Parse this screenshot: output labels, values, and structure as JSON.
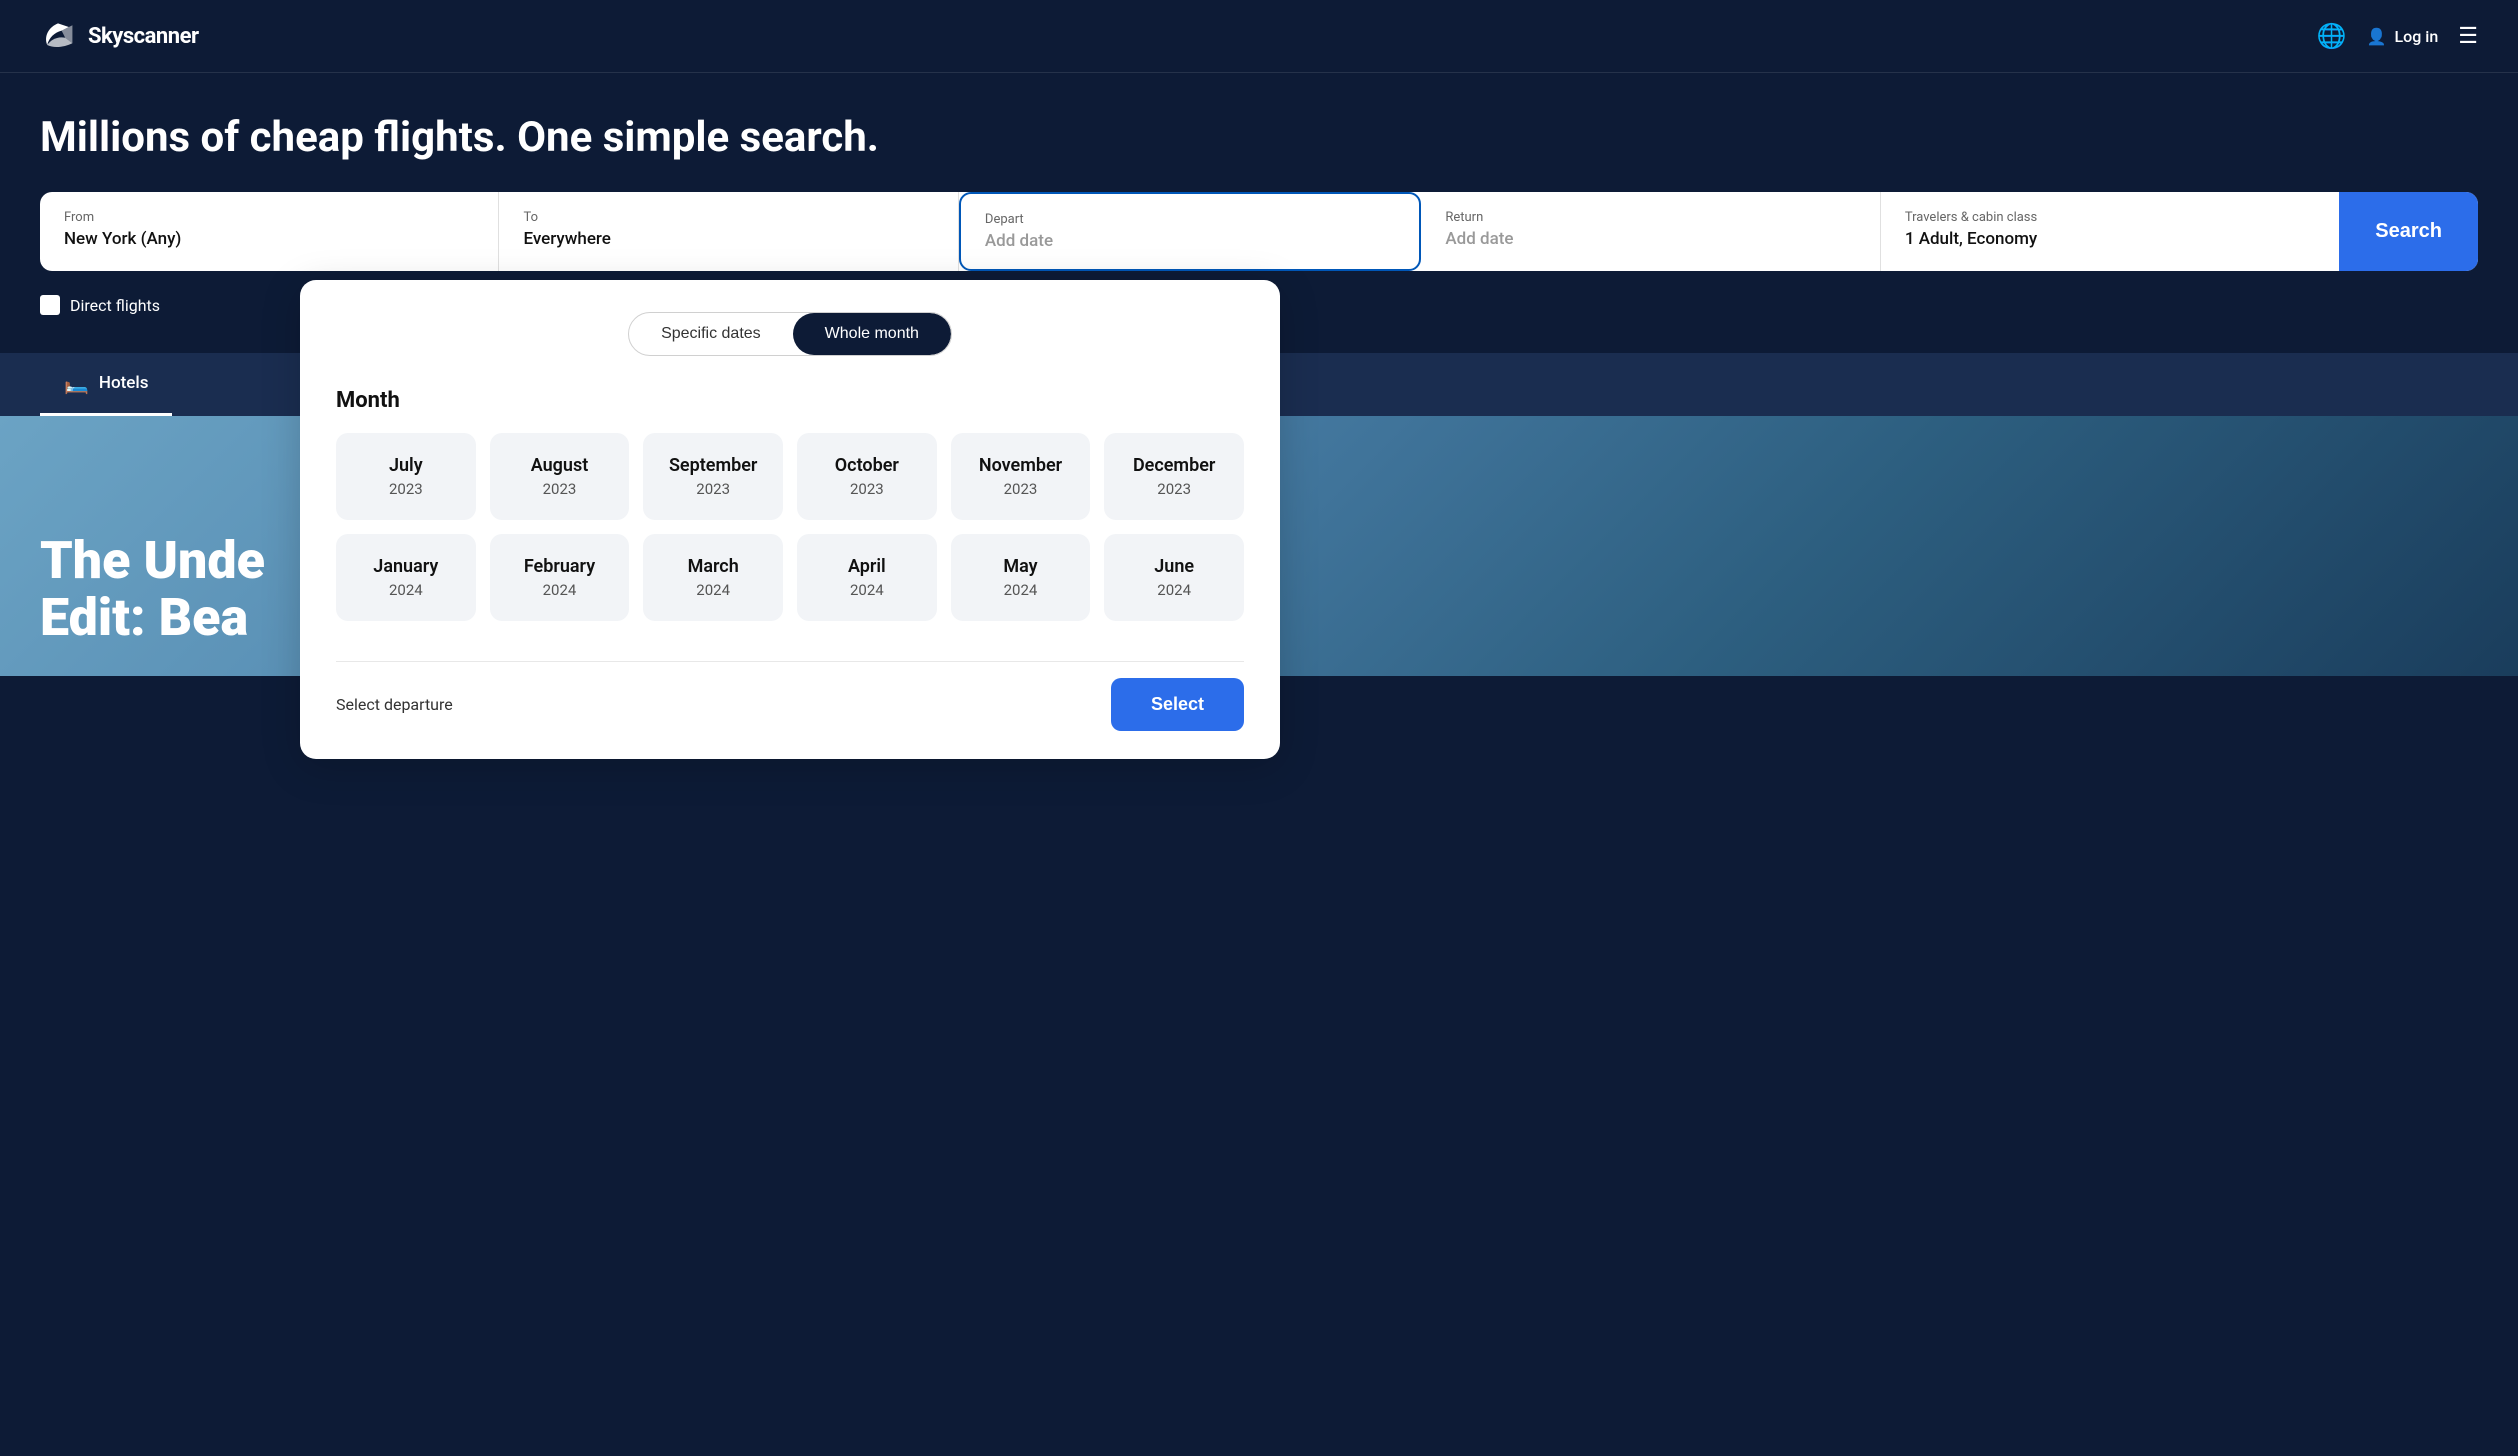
{
  "brand": {
    "name": "Skyscanner"
  },
  "navbar": {
    "logo_alt": "Skyscanner logo",
    "login_label": "Log in",
    "globe_icon": "🌐",
    "user_icon": "👤",
    "menu_icon": "☰"
  },
  "hero": {
    "title": "Millions of cheap flights. One simple search."
  },
  "search": {
    "from_label": "From",
    "from_value": "New York (Any)",
    "to_label": "To",
    "to_value": "Everywhere",
    "depart_label": "Depart",
    "depart_placeholder": "Add date",
    "return_label": "Return",
    "return_placeholder": "Add date",
    "travelers_label": "Travelers & cabin class",
    "travelers_value": "1 Adult, Economy",
    "search_btn": "Search",
    "direct_flights_label": "Direct flights"
  },
  "tabs": [
    {
      "id": "hotels",
      "label": "Hotels",
      "icon": "🛏️"
    }
  ],
  "dropdown": {
    "toggle": {
      "specific_dates": "Specific dates",
      "whole_month": "Whole month",
      "active": "whole_month"
    },
    "month_section_label": "Month",
    "months": [
      {
        "name": "July",
        "year": "2023"
      },
      {
        "name": "August",
        "year": "2023"
      },
      {
        "name": "September",
        "year": "2023"
      },
      {
        "name": "October",
        "year": "2023"
      },
      {
        "name": "November",
        "year": "2023"
      },
      {
        "name": "December",
        "year": "2023"
      },
      {
        "name": "January",
        "year": "2024"
      },
      {
        "name": "February",
        "year": "2024"
      },
      {
        "name": "March",
        "year": "2024"
      },
      {
        "name": "April",
        "year": "2024"
      },
      {
        "name": "May",
        "year": "2024"
      },
      {
        "name": "June",
        "year": "2024"
      }
    ],
    "footer_label": "Select departure",
    "select_btn": "Select"
  },
  "bg_text_line1": "The Unde",
  "bg_text_line2": "Edit: Bea"
}
